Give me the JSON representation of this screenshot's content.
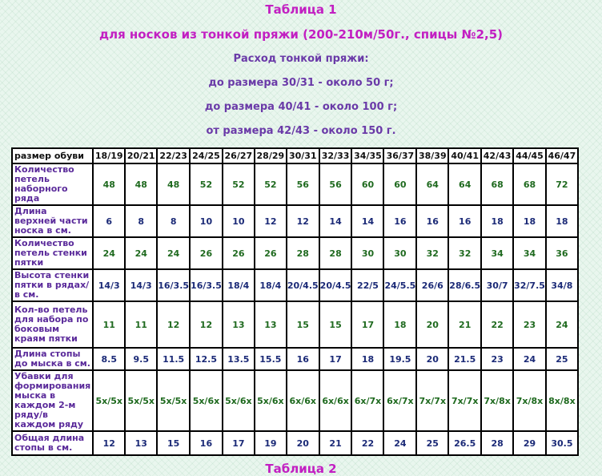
{
  "headings": {
    "table_title": "Таблица 1",
    "subtitle": "для носков из тонкой пряжи (200-210м/50г., спицы №2,5)",
    "consumption_title": "Расход тонкой пряжи:",
    "line_1": "до размера 30/31 - около 50 г;",
    "line_2": "до размера 40/41 - около 100 г;",
    "line_3": "от размера 42/43 - около 150 г.",
    "next_table_title": "Таблица 2"
  },
  "table": {
    "corner_label": "размер обуви",
    "sizes": [
      "18/19",
      "20/21",
      "22/23",
      "24/25",
      "26/27",
      "28/29",
      "30/31",
      "32/33",
      "34/35",
      "36/37",
      "38/39",
      "40/41",
      "42/43",
      "44/45",
      "46/47"
    ],
    "rows": [
      {
        "label": "Количество петель наборного ряда",
        "tone": "green",
        "values": [
          "48",
          "48",
          "48",
          "52",
          "52",
          "52",
          "56",
          "56",
          "60",
          "60",
          "64",
          "64",
          "68",
          "68",
          "72"
        ]
      },
      {
        "label": "Длина верхней части носка в см.",
        "tone": "navy",
        "values": [
          "6",
          "8",
          "8",
          "10",
          "10",
          "12",
          "12",
          "14",
          "14",
          "16",
          "16",
          "16",
          "18",
          "18",
          "18"
        ]
      },
      {
        "label": "Количество петель стенки пятки",
        "tone": "green",
        "values": [
          "24",
          "24",
          "24",
          "26",
          "26",
          "26",
          "28",
          "28",
          "30",
          "30",
          "32",
          "32",
          "34",
          "34",
          "36"
        ]
      },
      {
        "label": "Высота стенки пятки в рядах/в см.",
        "tone": "navy",
        "values": [
          "14/3",
          "14/3",
          "16/3.5",
          "16/3.5",
          "18/4",
          "18/4",
          "20/4.5",
          "20/4.5",
          "22/5",
          "24/5.5",
          "26/6",
          "28/6.5",
          "30/7",
          "32/7.5",
          "34/8"
        ]
      },
      {
        "label": "Кол-во петель для набора по боковым краям пятки",
        "tone": "green",
        "values": [
          "11",
          "11",
          "12",
          "12",
          "13",
          "13",
          "15",
          "15",
          "17",
          "18",
          "20",
          "21",
          "22",
          "23",
          "24"
        ]
      },
      {
        "label": "Длина стопы до мыска в см.",
        "tone": "navy",
        "values": [
          "8.5",
          "9.5",
          "11.5",
          "12.5",
          "13.5",
          "15.5",
          "16",
          "17",
          "18",
          "19.5",
          "20",
          "21.5",
          "23",
          "24",
          "25"
        ]
      },
      {
        "label": "Убавки для формирования мыска в каждом 2-м ряду/в каждом ряду",
        "tone": "green",
        "values": [
          "5x/5x",
          "5x/5x",
          "5x/5x",
          "5x/6x",
          "5x/6x",
          "5x/6x",
          "6x/6x",
          "6x/6x",
          "6x/7x",
          "6x/7x",
          "7x/7x",
          "7x/7x",
          "7x/8x",
          "7x/8x",
          "8x/8x"
        ]
      },
      {
        "label": "Общая длина стопы в см.",
        "tone": "navy",
        "values": [
          "12",
          "13",
          "15",
          "16",
          "17",
          "19",
          "20",
          "21",
          "22",
          "24",
          "25",
          "26.5",
          "28",
          "29",
          "30.5"
        ]
      }
    ]
  }
}
